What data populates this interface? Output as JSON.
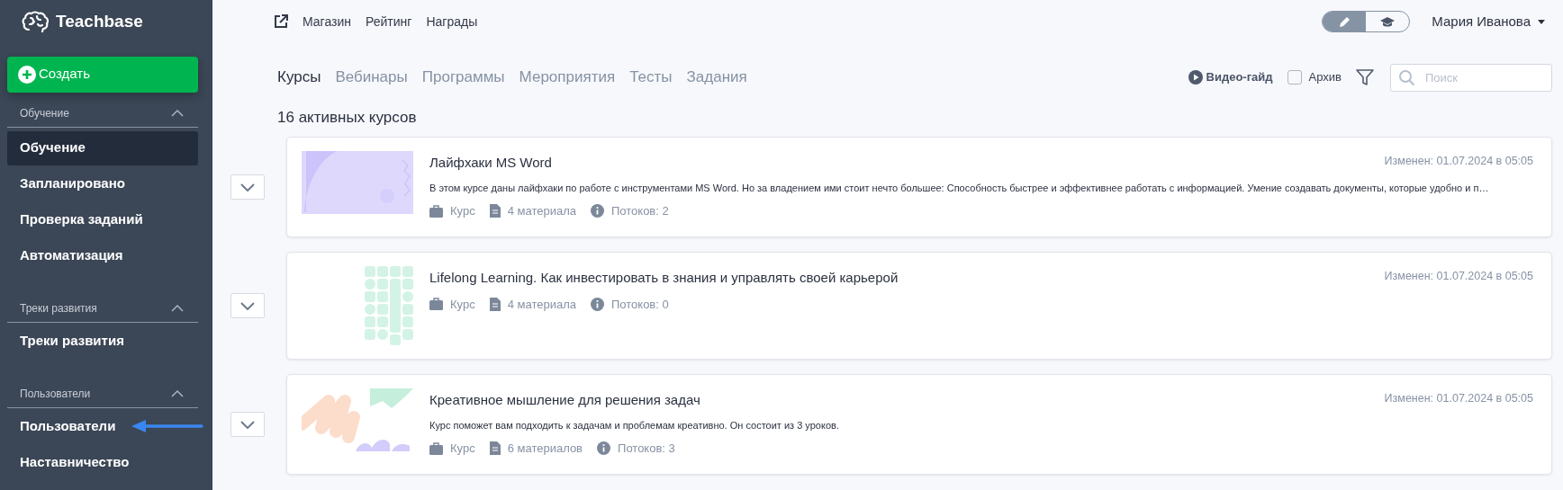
{
  "sidebar": {
    "logo": "Teachbase",
    "create_button": "Создать",
    "sections": [
      {
        "title": "Обучение",
        "expanded": true,
        "items": [
          {
            "label": "Обучение",
            "selected": true
          },
          {
            "label": "Запланировано",
            "selected": false
          },
          {
            "label": "Проверка заданий",
            "selected": false
          },
          {
            "label": "Автоматизация",
            "selected": false
          }
        ]
      },
      {
        "title": "Треки развития",
        "expanded": true,
        "items": [
          {
            "label": "Треки развития",
            "selected": false
          }
        ]
      },
      {
        "title": "Пользователи",
        "expanded": true,
        "items": [
          {
            "label": "Пользователи",
            "selected": false
          },
          {
            "label": "Наставничество",
            "selected": false
          }
        ]
      }
    ]
  },
  "top_links": [
    "Магазин",
    "Рейтинг",
    "Награды"
  ],
  "mode_toggle": [
    {
      "kind": "edit",
      "selected": true
    },
    {
      "kind": "learn",
      "selected": false
    }
  ],
  "user_menu": "Мария Иванова",
  "tabs": [
    {
      "label": "Курсы",
      "selected": true
    },
    {
      "label": "Вебинары",
      "selected": false
    },
    {
      "label": "Программы",
      "selected": false
    },
    {
      "label": "Мероприятия",
      "selected": false
    },
    {
      "label": "Тесты",
      "selected": false
    },
    {
      "label": "Задания",
      "selected": false
    }
  ],
  "toolbar": {
    "video_guide": "Видео-гайд",
    "archive": {
      "label": "Архив",
      "checked": false
    },
    "search": {
      "placeholder": "Поиск"
    }
  },
  "course_count": "16 активных курсов",
  "courses": [
    {
      "title": "Лайфхаки MS Word",
      "description": "В этом курсе даны лайфхаки по работе с инструментами MS Word. Но за владением ими стоит нечто большее: Способность быстрее и эффективнее работать с информацией. Умение создавать документы, которые удобно и п…",
      "type": "Курс",
      "materials": "4 материала",
      "streams": "Потоков: 2",
      "modified": "Изменен: 01.07.2024 в 05:05"
    },
    {
      "title": "Lifelong Learning. Как инвестировать в знания и управлять своей карьерой",
      "type": "Курс",
      "materials": "4 материала",
      "streams": "Потоков: 0",
      "modified": "Изменен: 01.07.2024 в 05:05"
    },
    {
      "title": "Креативное мышление для решения задач",
      "description": "Курс поможет вам подходить к задачам и проблемам креативно. Он состоит из 3 уроков.",
      "type": "Курс",
      "materials": "6 материалов",
      "streams": "Потоков: 3",
      "modified": "Изменен: 01.07.2024 в 05:05"
    }
  ]
}
